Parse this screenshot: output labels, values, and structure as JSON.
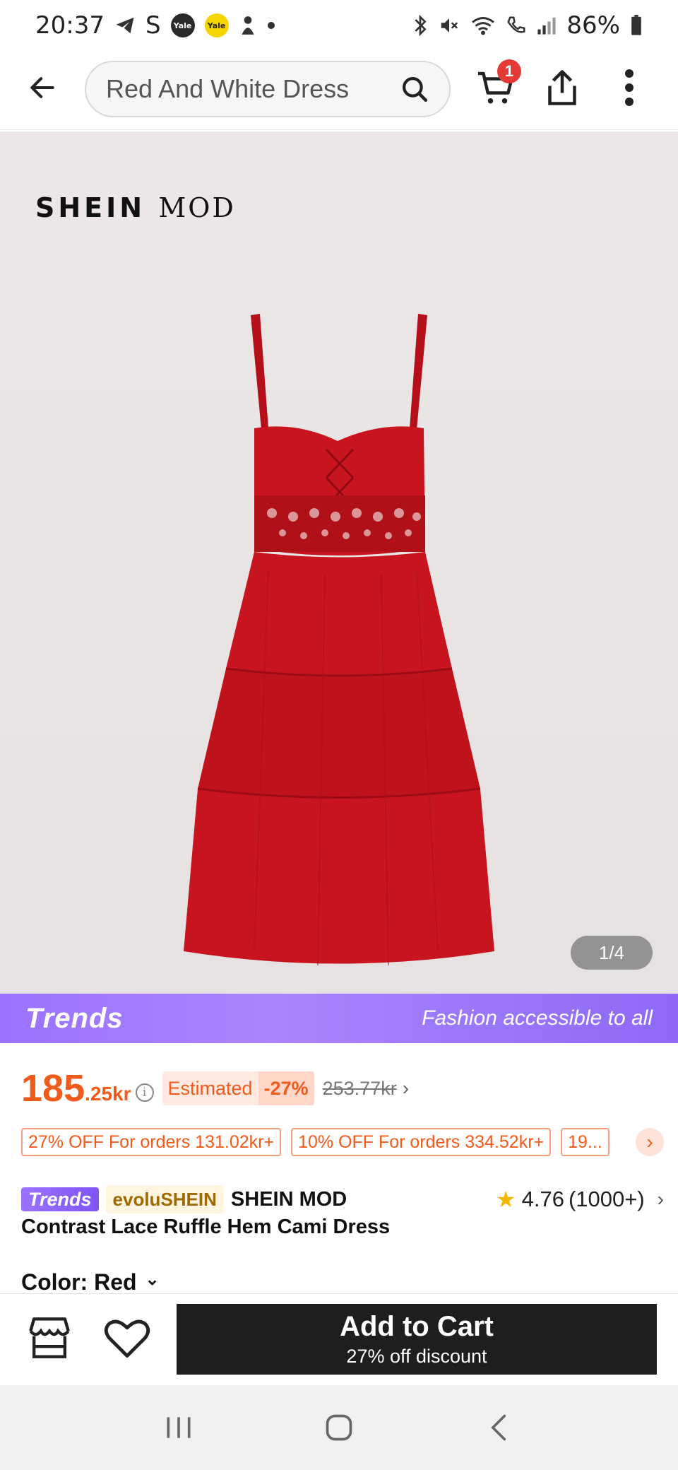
{
  "status_bar": {
    "time": "20:37",
    "battery": "86%",
    "yale_label": "Yale"
  },
  "header": {
    "search_text": "Red And White Dress",
    "cart_count": "1"
  },
  "gallery": {
    "brand_logo_main": "SHEIN",
    "brand_logo_mod": "MOD",
    "counter": "1/4"
  },
  "trends_banner": {
    "logo": "Trends",
    "tagline": "Fashion accessible to all"
  },
  "price": {
    "main": "185",
    "small": ".25kr",
    "estimated_label": "Estimated",
    "discount": "-27%",
    "original": "253.77kr"
  },
  "coupons": [
    "27% OFF For orders 131.02kr+",
    "10% OFF For orders 334.52kr+",
    "19..."
  ],
  "product": {
    "trends_chip": "Trends",
    "evolu_chip": "evoluSHEIN",
    "brand": "SHEIN MOD",
    "title": "Contrast Lace Ruffle Hem Cami Dress",
    "rating": "4.76",
    "rating_count": "(1000+)",
    "color_label": "Color: Red"
  },
  "action_bar": {
    "add_to_cart": "Add to Cart",
    "discount_note": "27% off discount"
  },
  "colors": {
    "accent_orange": "#f05a1a",
    "trends_purple": "#9a72ff",
    "dress_red": "#c8141e",
    "cart_button": "#1e1e1e"
  }
}
